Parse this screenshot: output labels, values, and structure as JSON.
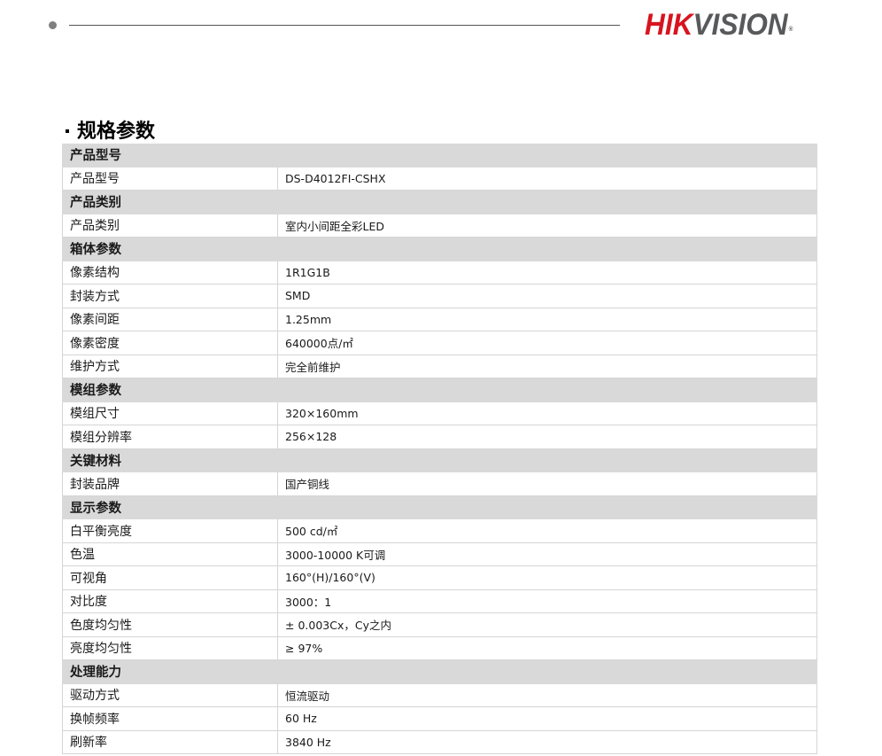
{
  "header": {
    "logo_primary": "HIK",
    "logo_secondary": "VISION",
    "logo_mark": "®"
  },
  "section": {
    "title": "规格参数"
  },
  "spec_groups": [
    {
      "name": "产品型号",
      "rows": [
        {
          "label": "产品型号",
          "value": "DS-D4012FI-CSHX"
        }
      ]
    },
    {
      "name": "产品类别",
      "rows": [
        {
          "label": "产品类别",
          "value": "室内小间距全彩LED"
        }
      ]
    },
    {
      "name": "箱体参数",
      "rows": [
        {
          "label": "像素结构",
          "value": "1R1G1B"
        },
        {
          "label": "封装方式",
          "value": "SMD"
        },
        {
          "label": "像素间距",
          "value": "1.25mm"
        },
        {
          "label": "像素密度",
          "value": "640000点/㎡"
        },
        {
          "label": "维护方式",
          "value": "完全前维护"
        }
      ]
    },
    {
      "name": "模组参数",
      "rows": [
        {
          "label": "模组尺寸",
          "value": "320×160mm"
        },
        {
          "label": "模组分辨率",
          "value": "256×128"
        }
      ]
    },
    {
      "name": "关键材料",
      "rows": [
        {
          "label": "封装品牌",
          "value": "国产铜线"
        }
      ]
    },
    {
      "name": "显示参数",
      "rows": [
        {
          "label": "白平衡亮度",
          "value": "500 cd/㎡"
        },
        {
          "label": "色温",
          "value": "3000-10000 K可调"
        },
        {
          "label": "可视角",
          "value": "160°(H)/160°(V)"
        },
        {
          "label": "对比度",
          "value": "3000：1"
        },
        {
          "label": "色度均匀性",
          "value": "± 0.003Cx，Cy之内"
        },
        {
          "label": "亮度均匀性",
          "value": "≥ 97%"
        }
      ]
    },
    {
      "name": "处理能力",
      "rows": [
        {
          "label": "驱动方式",
          "value": "恒流驱动"
        },
        {
          "label": "换帧频率",
          "value": "60 Hz"
        },
        {
          "label": "刷新率",
          "value": "3840 Hz"
        }
      ]
    }
  ]
}
